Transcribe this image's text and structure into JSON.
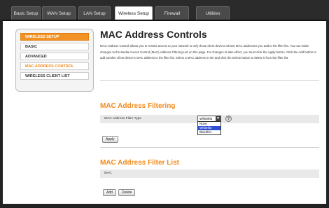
{
  "tabs": [
    "Basic Setup",
    "WAN Setup",
    "LAN Setup",
    "Wireless Setup",
    "Firewall",
    "Utilities"
  ],
  "active_tab": "Wireless Setup",
  "sidebar": {
    "items": [
      {
        "label": "WIRELESS SETUP"
      },
      {
        "label": "BASIC"
      },
      {
        "label": "ADVANCED"
      },
      {
        "label": "MAC ADDRESS CONTROL"
      },
      {
        "label": "WIRELESS CLIENT LIST"
      }
    ]
  },
  "page": {
    "title": "MAC Address Controls",
    "description": "MAC Address Control allows you to restrict access to your network to only those client devices whose MAC addresses you add to the filter list. You can make changes to the Media Access Control (MAC) Address Filtering List on this page. For changes to take effect, you must click the Apply button. Click the Add button to add another client device's MAC address to the filter list. Select a MAC address in the and click the Delete button to delete it from the filter list."
  },
  "filtering": {
    "heading": "MAC Address Filtering",
    "type_label": "MAC Address Filter Type",
    "selected": "Whitelist",
    "options": [
      "None",
      "Whitelist",
      "Blacklist"
    ],
    "apply_label": "Apply",
    "help_icon": "help-icon"
  },
  "filter_list": {
    "heading": "MAC Address Filter List",
    "column": "MAC",
    "add_label": "Add",
    "delete_label": "Delete"
  }
}
